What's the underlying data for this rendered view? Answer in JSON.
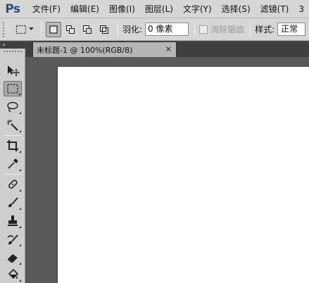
{
  "app": {
    "logo": "Ps"
  },
  "menu": [
    {
      "label": "文件(F)"
    },
    {
      "label": "编辑(E)"
    },
    {
      "label": "图像(I)"
    },
    {
      "label": "图层(L)"
    },
    {
      "label": "文字(Y)"
    },
    {
      "label": "选择(S)"
    },
    {
      "label": "滤镜(T)"
    },
    {
      "label": "3"
    }
  ],
  "options": {
    "feather_label": "羽化:",
    "feather_value": "0 像素",
    "antialias_label": "消除锯齿",
    "style_label": "样式:",
    "style_value": "正常"
  },
  "tools_header": {
    "collapse": "»"
  },
  "document": {
    "tab_title": "未标题-1 @ 100%(RGB/8)",
    "close_glyph": "×"
  },
  "icons": {
    "move": "move-tool-icon",
    "marquee": "rectangular-marquee-icon",
    "lasso": "lasso-icon",
    "magic_wand": "magic-wand-icon",
    "crop": "crop-icon",
    "eyedropper": "eyedropper-icon",
    "healing": "healing-brush-icon",
    "brush": "brush-icon",
    "stamp": "clone-stamp-icon",
    "history_brush": "history-brush-icon",
    "eraser": "eraser-icon",
    "bucket": "paint-bucket-icon"
  },
  "colors": {
    "chrome": "#d6d6d6",
    "panel_dark": "#3f3f3f",
    "workspace": "#595959",
    "logo": "#2d4f7e"
  }
}
